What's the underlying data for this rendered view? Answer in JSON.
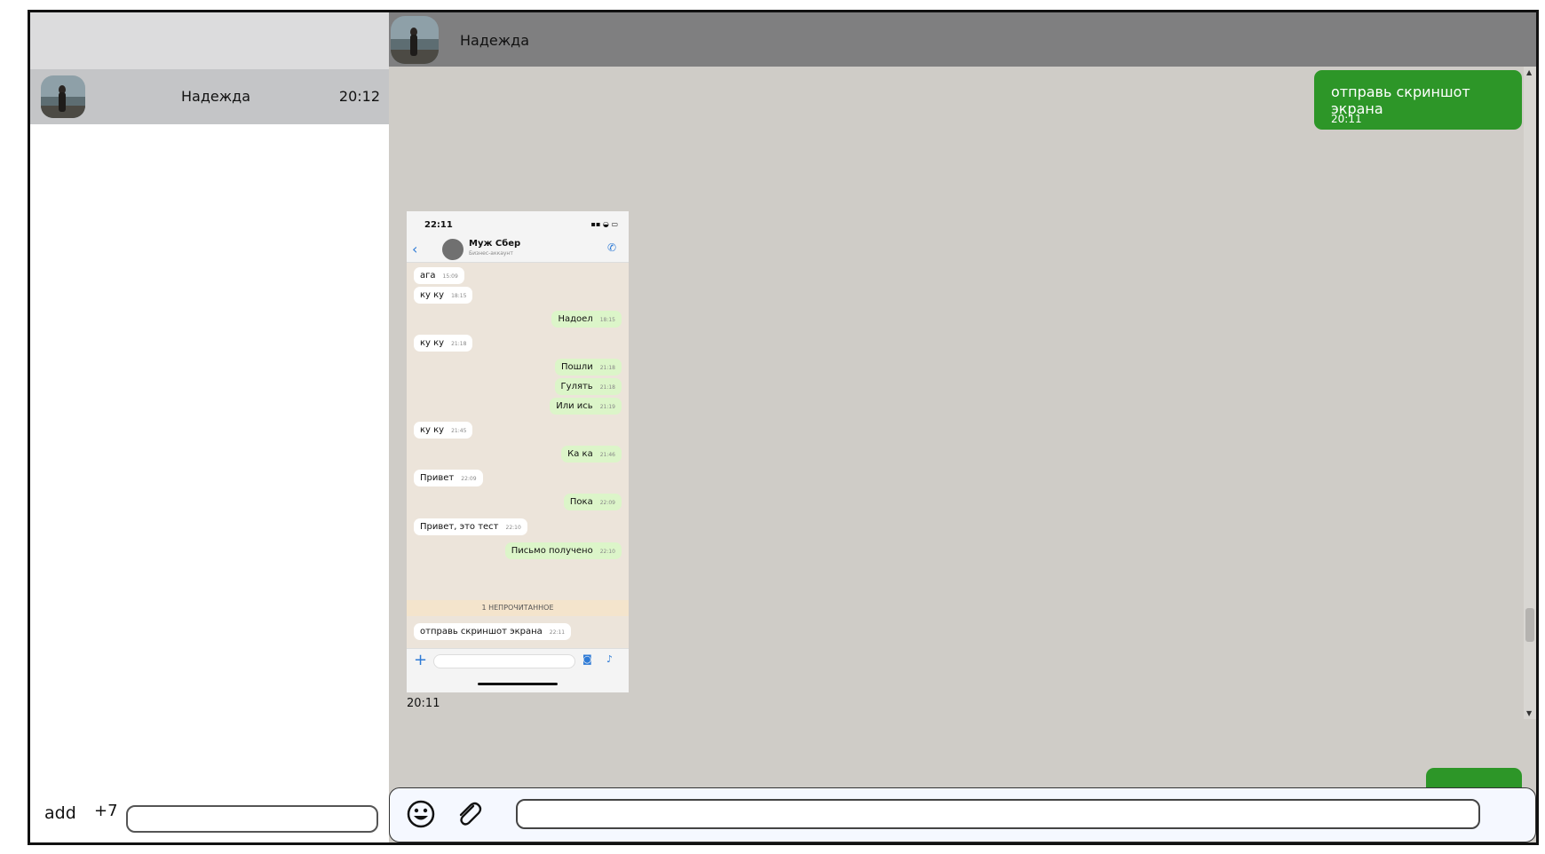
{
  "sidebar": {
    "chats": [
      {
        "name": "Надежда",
        "time": "20:12"
      }
    ],
    "footer": {
      "add_label": "add",
      "country_code": "+7",
      "phone_value": ""
    }
  },
  "chat": {
    "contact_name": "Надежда",
    "messages": [
      {
        "direction": "out",
        "text": "отправь скриншот экрана",
        "time": "20:11"
      },
      {
        "direction": "in",
        "type": "image",
        "time": "20:11"
      }
    ],
    "composer": {
      "value": "",
      "emoji_icon": "smiley-icon",
      "attach_icon": "paperclip-icon"
    }
  },
  "screenshot": {
    "clock": "22:11",
    "status_icons": "▪▪ ◒ ▭",
    "contact": "Муж Сбер",
    "subtitle": "Бизнес-аккаунт",
    "messages": [
      {
        "dir": "in",
        "text": "ага",
        "time": "15:09"
      },
      {
        "dir": "in",
        "text": "ку ку",
        "time": "18:15"
      },
      {
        "dir": "out",
        "text": "Надоел",
        "time": "18:15"
      },
      {
        "dir": "in",
        "text": "ку ку",
        "time": "21:18"
      },
      {
        "dir": "out",
        "text": "Пошли",
        "time": "21:18"
      },
      {
        "dir": "out",
        "text": "Гулять",
        "time": "21:18"
      },
      {
        "dir": "out",
        "text": "Или ись",
        "time": "21:19"
      },
      {
        "dir": "in",
        "text": "ку ку",
        "time": "21:45"
      },
      {
        "dir": "out",
        "text": "Ка ка",
        "time": "21:46"
      },
      {
        "dir": "in",
        "text": "Привет",
        "time": "22:09"
      },
      {
        "dir": "out",
        "text": "Пока",
        "time": "22:09"
      },
      {
        "dir": "in",
        "text": "Привет, это тест",
        "time": "22:10"
      },
      {
        "dir": "out",
        "text": "Письмо получено",
        "time": "22:10"
      }
    ],
    "unread_label": "1 НЕПРОЧИТАННОЕ",
    "last_message": {
      "dir": "in",
      "text": "отправь скриншот экрана",
      "time": "22:11"
    }
  }
}
